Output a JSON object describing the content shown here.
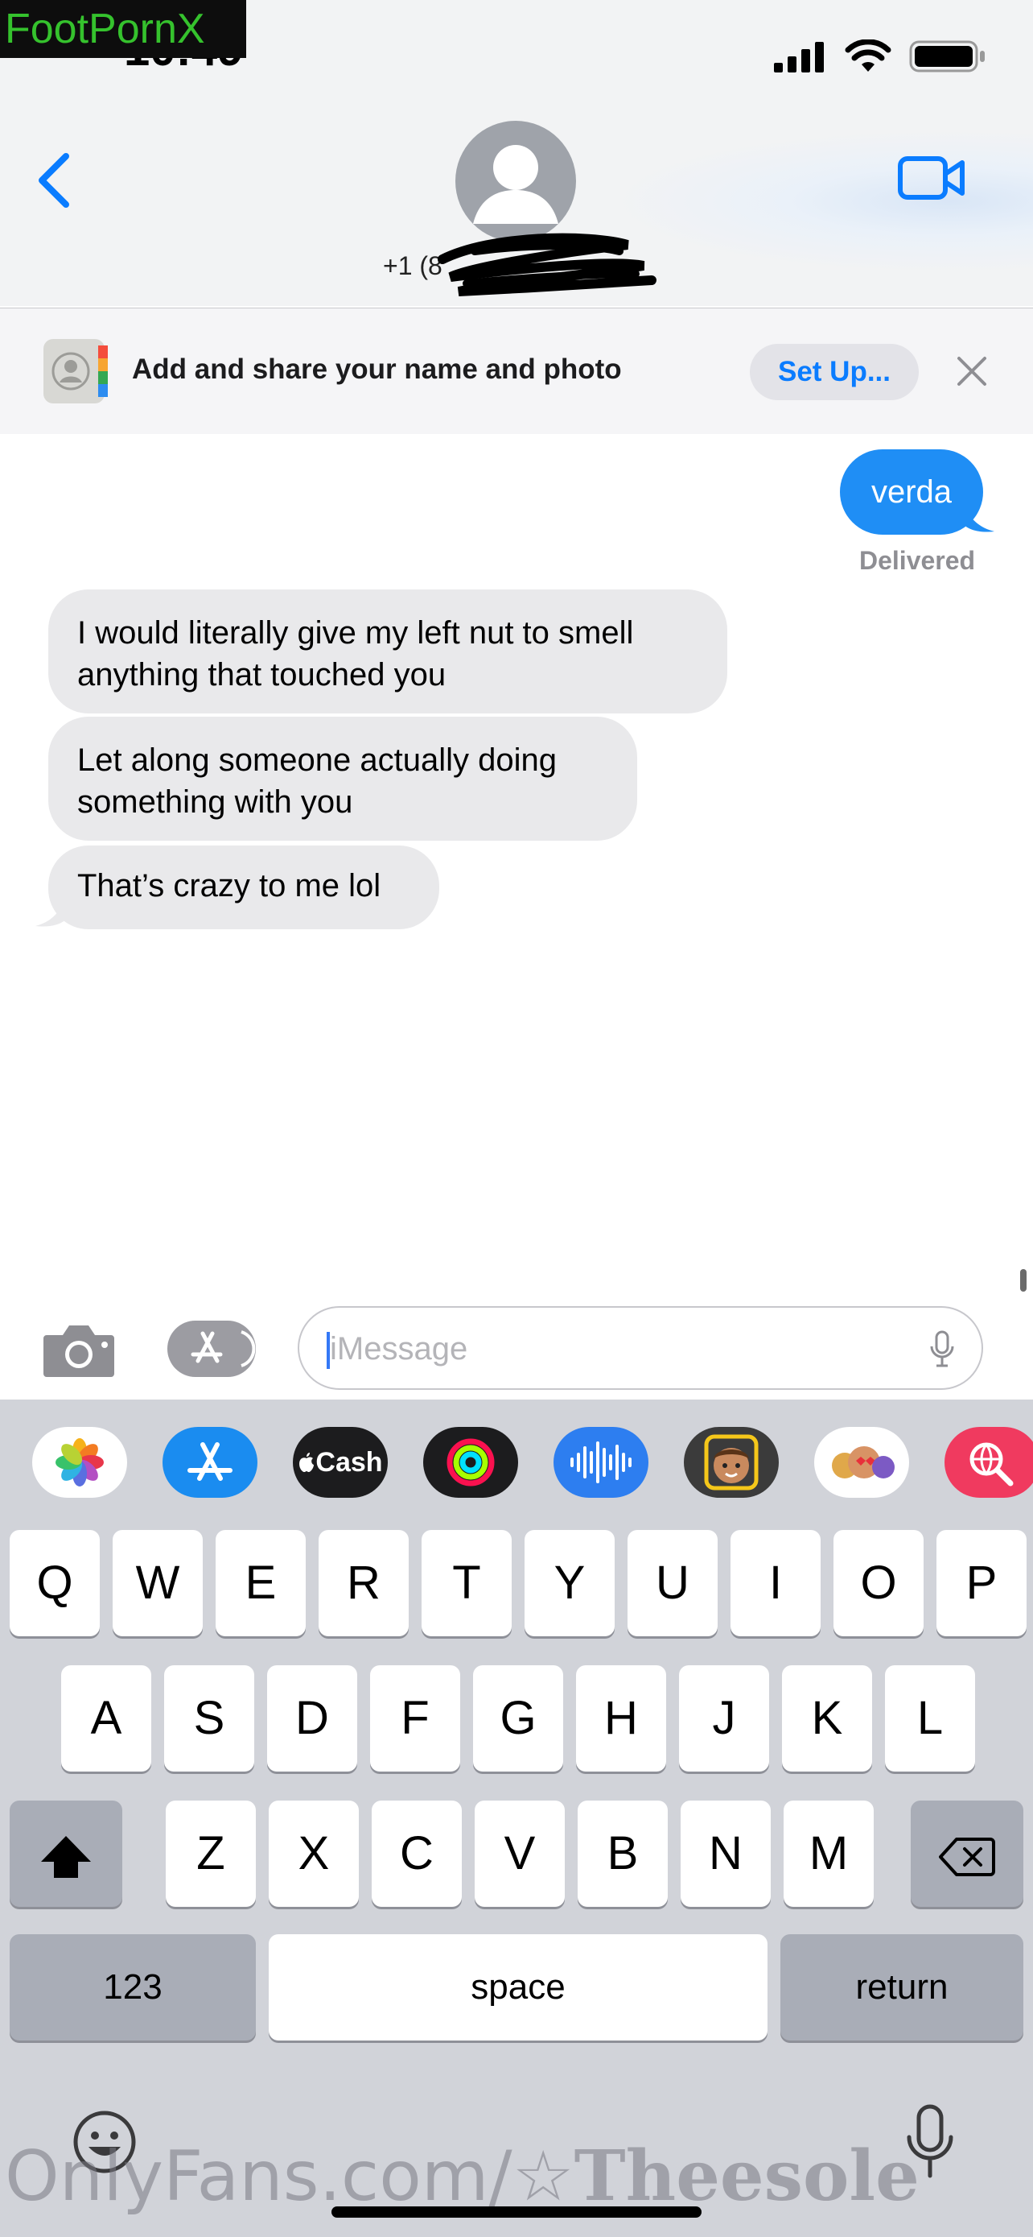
{
  "watermark_top": "FootPornX",
  "status_bar": {
    "time": "10:49"
  },
  "contact": {
    "phone": "+1 (8"
  },
  "setup_banner": {
    "text": "Add and share your name and photo",
    "button": "Set Up..."
  },
  "messages": [
    {
      "direction": "outgoing",
      "text": "verda"
    },
    {
      "direction": "incoming",
      "text": "I would literally give my left nut to smell anything that touched you"
    },
    {
      "direction": "incoming",
      "text": "Let along someone actually doing something with you"
    },
    {
      "direction": "incoming",
      "text": "That’s crazy to me lol"
    }
  ],
  "delivery_status": "Delivered",
  "input": {
    "placeholder": "iMessage",
    "value": ""
  },
  "app_strip": [
    "photos-icon",
    "app-store-icon",
    "apple-cash-icon",
    "activity-icon",
    "voice-memo-icon",
    "memoji-icon",
    "memoji-stickers-icon",
    "web-search-icon"
  ],
  "apple_cash_label": "Cash",
  "keyboard": {
    "row1": [
      "Q",
      "W",
      "E",
      "R",
      "T",
      "Y",
      "U",
      "I",
      "O",
      "P"
    ],
    "row2": [
      "A",
      "S",
      "D",
      "F",
      "G",
      "H",
      "J",
      "K",
      "L"
    ],
    "row3": [
      "Z",
      "X",
      "C",
      "V",
      "B",
      "N",
      "M"
    ],
    "numbers_key": "123",
    "space_key": "space",
    "return_key": "return"
  },
  "watermark_bottom": {
    "prefix": "OnlyFans.com/",
    "star": "☆",
    "name": "Theesole"
  },
  "colors": {
    "accent_blue": "#1f8ef5",
    "link_blue": "#0a7cff",
    "incoming_bubble": "#e9e9eb",
    "keyboard_bg": "#d1d3d9",
    "watermark_green": "#35c22d"
  }
}
